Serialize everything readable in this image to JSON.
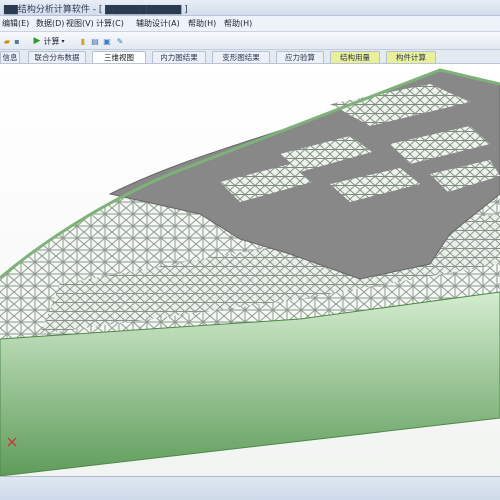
{
  "window": {
    "title": "▇▇结构分析计算软件 - [ ▇▇▇▇▇▇▇▇▇▇▇ ]"
  },
  "menu": [
    "编辑(E)",
    "数据(D)",
    "视图(V)",
    "计算(C)",
    "辅助设计(A)",
    "帮助(H)",
    "帮助(H)"
  ],
  "toolbar": {
    "run_label": "计算"
  },
  "tabs": [
    {
      "label": "信息",
      "state": "normal"
    },
    {
      "label": "联合分布数据",
      "state": "normal"
    },
    {
      "label": "三维视图",
      "state": "active"
    },
    {
      "label": "内力图结果",
      "state": "normal"
    },
    {
      "label": "变形图结果",
      "state": "normal"
    },
    {
      "label": "应力验算",
      "state": "normal"
    },
    {
      "label": "结构用量",
      "state": "highlight"
    },
    {
      "label": "构件计算",
      "state": "highlight"
    }
  ],
  "colors": {
    "roof": "#8a8a8a",
    "wall_top": "#cfe8cb",
    "wall_bottom": "#5e9a5a",
    "steel": "#d8d8d8",
    "background": "#ffffff"
  }
}
